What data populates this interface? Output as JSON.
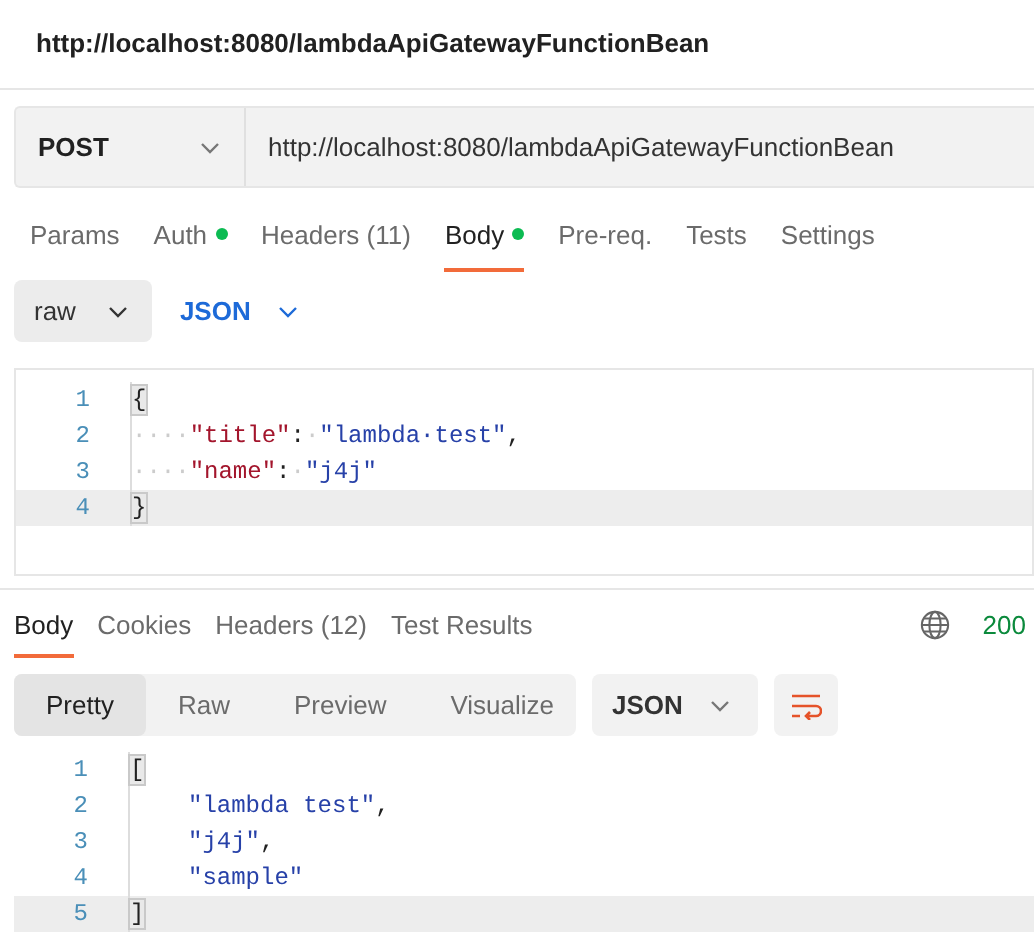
{
  "window": {
    "title": "http://localhost:8080/lambdaApiGatewayFunctionBean"
  },
  "request": {
    "method": "POST",
    "url": "http://localhost:8080/lambdaApiGatewayFunctionBean"
  },
  "request_tabs": [
    {
      "label": "Params",
      "selected": false,
      "dot": false
    },
    {
      "label": "Auth",
      "selected": false,
      "dot": true
    },
    {
      "label": "Headers (11)",
      "selected": false,
      "dot": false
    },
    {
      "label": "Body",
      "selected": true,
      "dot": true
    },
    {
      "label": "Pre-req.",
      "selected": false,
      "dot": false
    },
    {
      "label": "Tests",
      "selected": false,
      "dot": false
    },
    {
      "label": "Settings",
      "selected": false,
      "dot": false
    }
  ],
  "body_mode": {
    "type": "raw",
    "language": "JSON"
  },
  "request_body": [
    {
      "number": "1",
      "active": false,
      "tokens": [
        {
          "kind": "bracket",
          "text": "{"
        }
      ]
    },
    {
      "number": "2",
      "active": false,
      "tokens": [
        {
          "kind": "ws",
          "text": "····"
        },
        {
          "kind": "key",
          "text": "\"title\""
        },
        {
          "kind": "punct",
          "text": ":"
        },
        {
          "kind": "ws",
          "text": "·"
        },
        {
          "kind": "str",
          "text": "\"lambda·test\""
        },
        {
          "kind": "punct",
          "text": ","
        }
      ]
    },
    {
      "number": "3",
      "active": false,
      "tokens": [
        {
          "kind": "ws",
          "text": "····"
        },
        {
          "kind": "key",
          "text": "\"name\""
        },
        {
          "kind": "punct",
          "text": ":"
        },
        {
          "kind": "ws",
          "text": "·"
        },
        {
          "kind": "str",
          "text": "\"j4j\""
        }
      ]
    },
    {
      "number": "4",
      "active": true,
      "tokens": [
        {
          "kind": "bracket",
          "text": "}"
        }
      ]
    }
  ],
  "response_tabs": [
    {
      "label": "Body",
      "selected": true
    },
    {
      "label": "Cookies",
      "selected": false
    },
    {
      "label": "Headers (12)",
      "selected": false
    },
    {
      "label": "Test Results",
      "selected": false
    }
  ],
  "status": "200",
  "view_modes": [
    {
      "label": "Pretty",
      "selected": true
    },
    {
      "label": "Raw",
      "selected": false
    },
    {
      "label": "Preview",
      "selected": false
    },
    {
      "label": "Visualize",
      "selected": false
    }
  ],
  "response_format": "JSON",
  "response_body": [
    {
      "number": "1",
      "active": false,
      "tokens": [
        {
          "kind": "bracket",
          "text": "["
        }
      ]
    },
    {
      "number": "2",
      "active": false,
      "indented": true,
      "tokens": [
        {
          "kind": "str",
          "text": "\"lambda test\""
        },
        {
          "kind": "punct",
          "text": ","
        }
      ]
    },
    {
      "number": "3",
      "active": false,
      "indented": true,
      "tokens": [
        {
          "kind": "str",
          "text": "\"j4j\""
        },
        {
          "kind": "punct",
          "text": ","
        }
      ]
    },
    {
      "number": "4",
      "active": false,
      "indented": true,
      "tokens": [
        {
          "kind": "str",
          "text": "\"sample\""
        }
      ]
    },
    {
      "number": "5",
      "active": true,
      "tokens": [
        {
          "kind": "bracket",
          "text": "]"
        }
      ]
    }
  ]
}
